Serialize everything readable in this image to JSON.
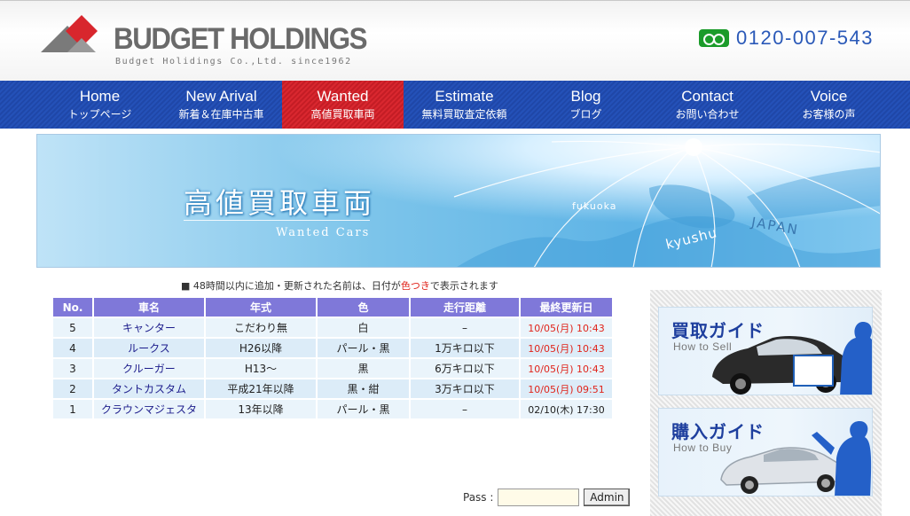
{
  "header": {
    "logo_text": "BUDGET HOLDINGS",
    "logo_sub": "Budget Holidings Co.,Ltd. since1962",
    "phone_icon": "freedial-icon",
    "phone": "0120-007-543"
  },
  "nav": [
    {
      "en": "Home",
      "jp": "トップページ"
    },
    {
      "en": "New Arival",
      "jp": "新着＆在庫中古車"
    },
    {
      "en": "Wanted",
      "jp": "高値買取車両"
    },
    {
      "en": "Estimate",
      "jp": "無料買取査定依頼"
    },
    {
      "en": "Blog",
      "jp": "ブログ"
    },
    {
      "en": "Contact",
      "jp": "お問い合わせ"
    },
    {
      "en": "Voice",
      "jp": "お客様の声"
    }
  ],
  "banner": {
    "title": "高値買取車両",
    "subtitle": "Wanted Cars",
    "map_fukuoka": "fukuoka",
    "map_kyushu": "kyushu",
    "map_japan": "JAPAN"
  },
  "notice": {
    "prefix": "■ 48時間以内に追加・更新された名前は、日付が",
    "highlight": "色つき",
    "suffix": "で表示されます"
  },
  "table": {
    "headers": [
      "No.",
      "車名",
      "年式",
      "色",
      "走行距離",
      "最終更新日"
    ],
    "rows": [
      [
        "5",
        "キャンター",
        "こだわり無",
        "白",
        "–",
        "10/05(月) 10:43"
      ],
      [
        "4",
        "ルークス",
        "H26以降",
        "パール・黒",
        "1万キロ以下",
        "10/05(月) 10:43"
      ],
      [
        "3",
        "クルーガー",
        "H13〜",
        "黒",
        "6万キロ以下",
        "10/05(月) 10:43"
      ],
      [
        "2",
        "タントカスタム",
        "平成21年以降",
        "黒・紺",
        "3万キロ以下",
        "10/05(月) 09:51"
      ],
      [
        "1",
        "クラウンマジェスタ",
        "13年以降",
        "パール・黒",
        "–",
        "02/10(木) 17:30"
      ]
    ]
  },
  "admin": {
    "label": "Pass :",
    "value": "",
    "button": "Admin"
  },
  "sidebar": {
    "sell_title": "買取ガイド",
    "sell_sub": "How to Sell",
    "buy_title": "購入ガイド",
    "buy_sub": "How to Buy"
  },
  "colors": {
    "nav_blue": "#2451b8",
    "nav_active_red": "#d9272f",
    "table_header": "#7f78d9",
    "new_date_red": "#e0241b"
  }
}
